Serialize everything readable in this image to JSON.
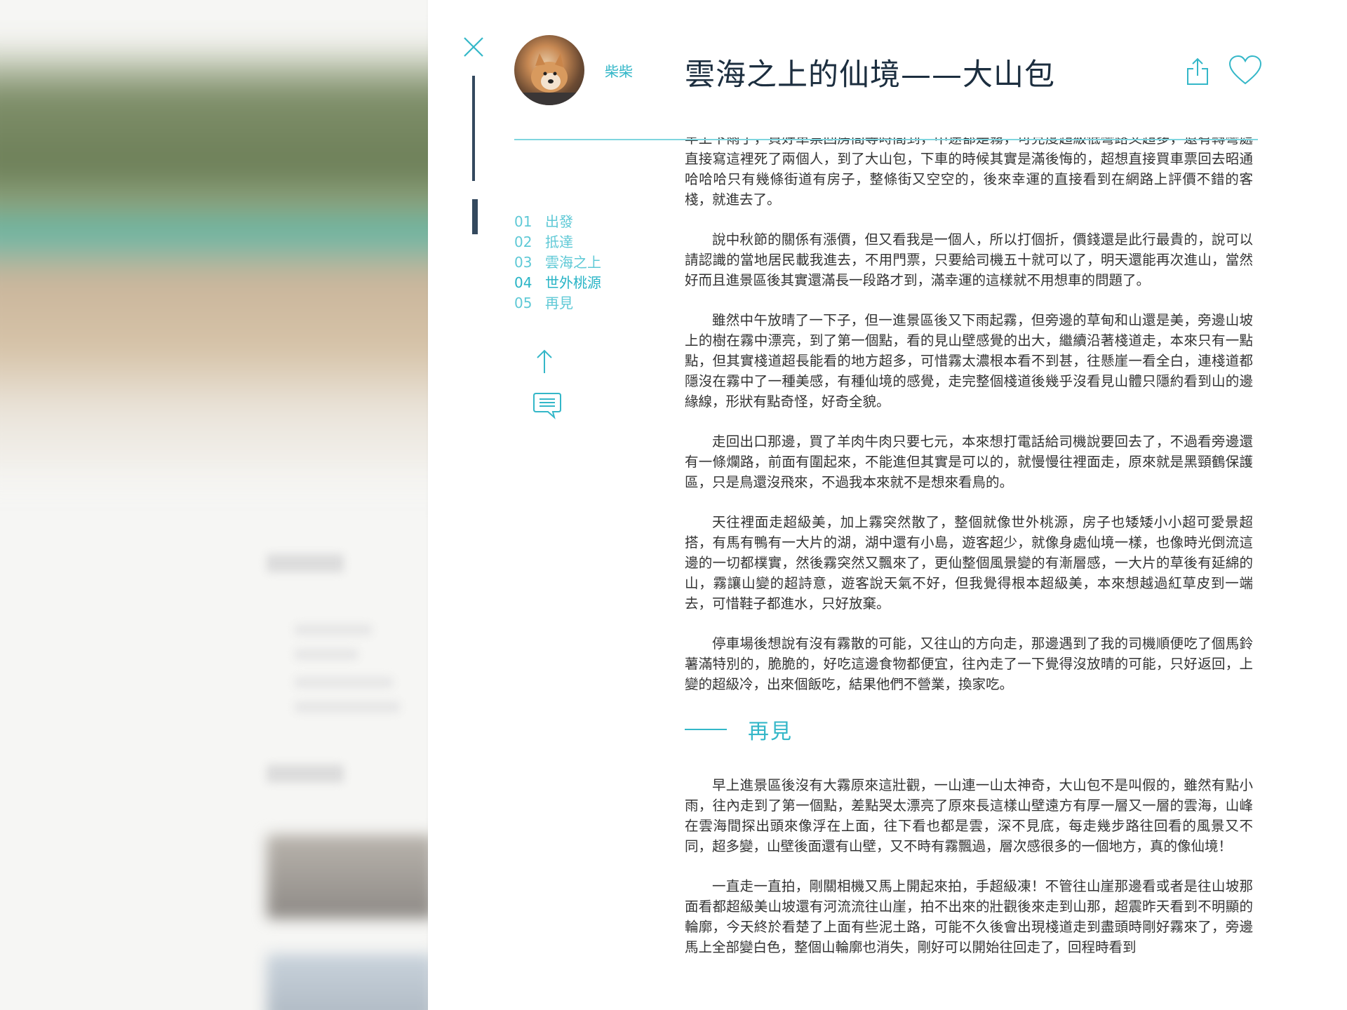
{
  "article": {
    "author": "柴柴",
    "title": "雲海之上的仙境——大山包"
  },
  "toc": [
    {
      "num": "01",
      "label": "出發"
    },
    {
      "num": "02",
      "label": "抵達"
    },
    {
      "num": "03",
      "label": "雲海之上"
    },
    {
      "num": "04",
      "label": "世外桃源",
      "active": true
    },
    {
      "num": "05",
      "label": "再見"
    }
  ],
  "content": {
    "paragraphs": [
      "早上下雨了，買好車票回房間等時間到，中途都是霧，可見度超級低彎路又超多，還有轉彎處直接寫這裡死了兩個人，到了大山包，下車的時候其實是滿後悔的，超想直接買車票回去昭通哈哈哈只有幾條街道有房子，整條街又空空的，後來幸運的直接看到在網路上評價不錯的客棧，就進去了。",
      "說中秋節的關係有漲價，但又看我是一個人，所以打個折，價錢還是此行最貴的，說可以請認識的當地居民載我進去，不用門票，只要給司機五十就可以了，明天還能再次進山，當然好而且進景區後其實還滿長一段路才到，滿幸運的這樣就不用想車的問題了。",
      "雖然中午放晴了一下子，但一進景區後又下雨起霧，但旁邊的草甸和山還是美，旁邊山坡上的樹在霧中漂亮，到了第一個點，看的見山壁感覺的出大，繼續沿著棧道走，本來只有一點點，但其實棧道超長能看的地方超多，可惜霧太濃根本看不到甚，往懸崖一看全白，連棧道都隱沒在霧中了一種美感，有種仙境的感覺，走完整個棧道後幾乎沒看見山體只隱約看到山的邊緣線，形狀有點奇怪，好奇全貌。",
      "走回出口那邊，買了羊肉牛肉只要七元，本來想打電話給司機說要回去了，不過看旁邊還有一條爛路，前面有圍起來，不能進但其實是可以的，就慢慢往裡面走，原來就是黑頸鶴保護區，只是鳥還沒飛來，不過我本來就不是想來看鳥的。",
      "天往裡面走超級美，加上霧突然散了，整個就像世外桃源，房子也矮矮小小超可愛景超搭，有馬有鴨有一大片的湖，湖中還有小島，遊客超少，就像身處仙境一樣，也像時光倒流這邊的一切都樸實，然後霧突然又飄來了，更仙整個風景變的有漸層感，一大片的草後有延綿的山，霧讓山變的超詩意，遊客說天氣不好，但我覺得根本超級美，本來想越過紅草皮到一端去，可惜鞋子都進水，只好放棄。",
      "停車場後想說有沒有霧散的可能，又往山的方向走，那邊遇到了我的司機順便吃了個馬鈴薯滿特別的，脆脆的，好吃這邊食物都便宜，往內走了一下覺得沒放晴的可能，只好返回，上變的超級冷，出來個飯吃，結果他們不營業，換家吃。"
    ],
    "section_title": "再見",
    "section_paragraphs": [
      "早上進景區後沒有大霧原來這壯觀，一山連一山太神奇，大山包不是叫假的，雖然有點小雨，往內走到了第一個點，差點哭太漂亮了原來長這樣山壁遠方有厚一層又一層的雲海，山峰在雲海間探出頭來像浮在上面，往下看也都是雲，深不見底，每走幾步路往回看的風景又不同，超多變，山壁後面還有山壁，又不時有霧飄過，層次感很多的一個地方，真的像仙境！",
      "一直走一直拍，剛關相機又馬上開起來拍，手超級凍！不管往山崖那邊看或者是往山坡那面看都超級美山坡還有河流流往山崖，拍不出來的壯觀後來走到山那，超震昨天看到不明顯的輪廓，今天終於看楚了上面有些泥土路，可能不久後會出現棧道走到盡頭時剛好霧來了，旁邊馬上全部變白色，整個山輪廓也消失，剛好可以開始往回走了，回程時看到"
    ]
  },
  "colors": {
    "accent": "#34b7c8",
    "title": "#1c2e3f",
    "dark_bar": "#34495e",
    "text": "#333333"
  },
  "icons": [
    "close-icon",
    "share-icon",
    "heart-icon",
    "arrow-up-icon",
    "comment-icon"
  ]
}
